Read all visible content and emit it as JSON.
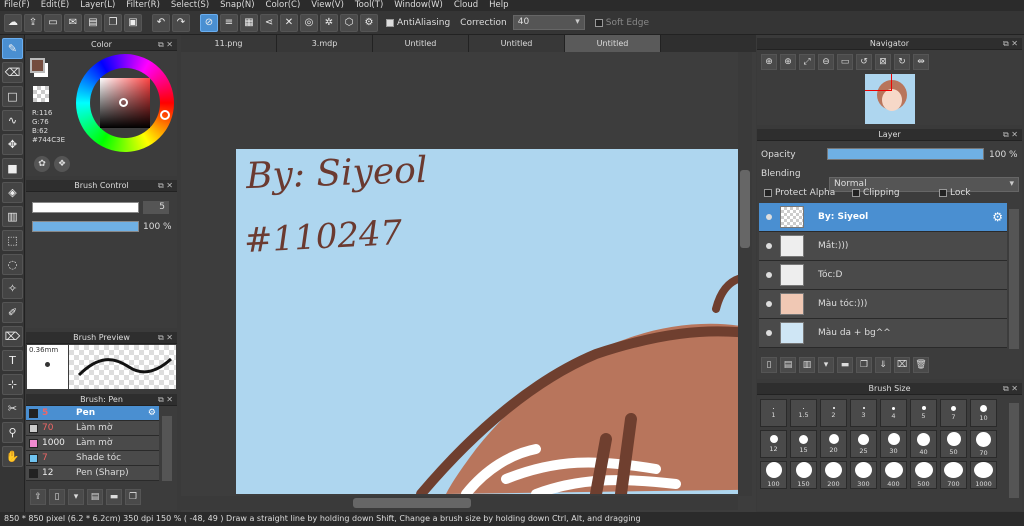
{
  "menu": [
    "File(F)",
    "Edit(E)",
    "Layer(L)",
    "Filter(R)",
    "Select(S)",
    "Snap(N)",
    "Color(C)",
    "View(V)",
    "Tool(T)",
    "Window(W)",
    "Cloud",
    "Help"
  ],
  "toolbar": {
    "antialiasing": "AntiAliasing",
    "correction_label": "Correction",
    "correction_value": "40",
    "soft_edge": "Soft Edge"
  },
  "color_panel": {
    "title": "Color",
    "r": "R:116",
    "g": "G:76",
    "b": "B:62",
    "hex": "#744C3E",
    "fg_color": "#744C3E"
  },
  "brush_control": {
    "title": "Brush Control",
    "size": "5",
    "opacity": "100 %"
  },
  "brush_preview": {
    "title": "Brush Preview",
    "size": "0.36mm"
  },
  "brush_panel": {
    "title": "Brush: Pen",
    "items": [
      {
        "size": "5",
        "name": "Pen",
        "color": "#222222"
      },
      {
        "size": "70",
        "name": "Làm mờ",
        "color": "#cccccc"
      },
      {
        "size": "1000",
        "name": "Làm mờ",
        "color": "#f08ad0"
      },
      {
        "size": "7",
        "name": "Shade tóc",
        "color": "#6fc3f0"
      },
      {
        "size": "12",
        "name": "Pen (Sharp)",
        "color": "#222222"
      }
    ]
  },
  "tabs": [
    "11.png",
    "3.mdp",
    "Untitled",
    "Untitled",
    "Untitled"
  ],
  "canvas": {
    "sketch_line1": "By: Siyeol",
    "sketch_line2": "#110247"
  },
  "navigator": {
    "title": "Navigator"
  },
  "layer_panel": {
    "title": "Layer",
    "opacity_label": "Opacity",
    "opacity_value": "100 %",
    "opacity_fraction": 1.0,
    "blending_label": "Blending",
    "blending_value": "Normal",
    "protect_alpha": "Protect Alpha",
    "clipping": "Clipping",
    "lock": "Lock",
    "layers": [
      "By: Siyeol",
      "Mắt:)))",
      "Tóc:D",
      "Màu tóc:)))",
      "Màu da + bg^^"
    ]
  },
  "brush_size": {
    "title": "Brush Size",
    "sizes": [
      "1",
      "1.5",
      "2",
      "3",
      "4",
      "5",
      "7",
      "10",
      "12",
      "15",
      "20",
      "25",
      "30",
      "40",
      "50",
      "70",
      "100",
      "150",
      "200",
      "300",
      "400",
      "500",
      "700",
      "1000"
    ]
  },
  "status": "850 * 850 pixel   (6.2 * 6.2cm)   350 dpi   150 %   ( -48, 49 )   Draw a straight line by holding down Shift, Change a brush size by holding down Ctrl, Alt, and dragging"
}
